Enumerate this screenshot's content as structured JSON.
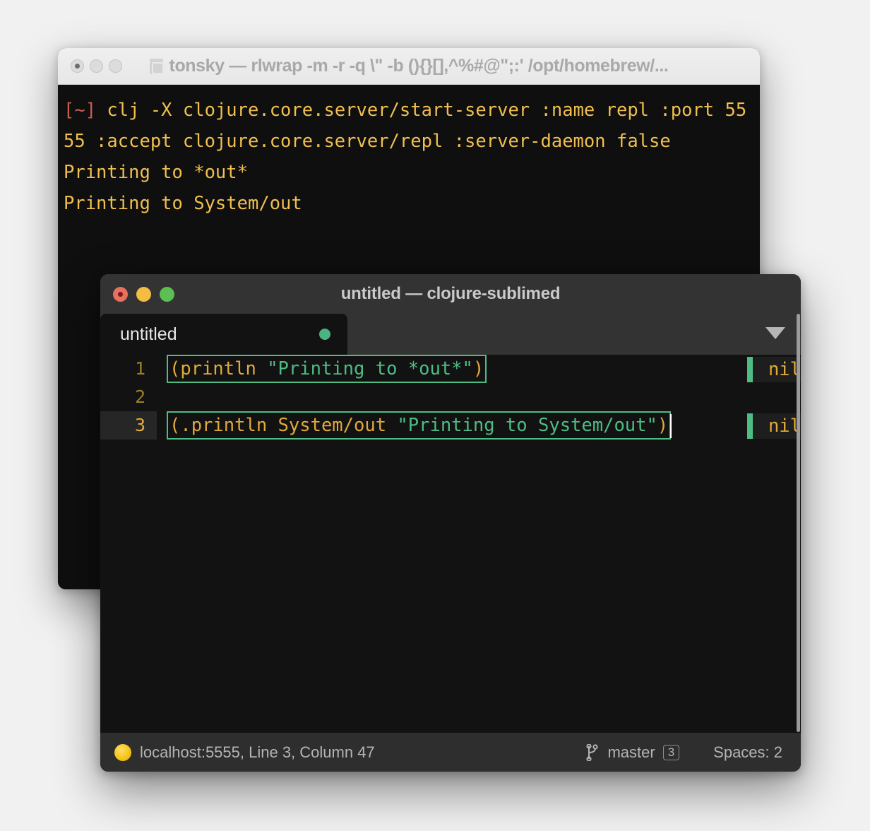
{
  "terminal": {
    "title": "tonsky — rlwrap -m -r -q \\\" -b (){}[],^%#@\";:' /opt/homebrew/...",
    "folder_icon": "folder-icon",
    "traffic_lights": [
      "close-inactive",
      "minimize-inactive",
      "zoom-inactive"
    ],
    "lines": [
      {
        "prompt": "[~]",
        "text": " clj -X clojure.core.server/start-server :name repl :port 5555 :accept clojure.core.server/repl :server-daemon false"
      },
      {
        "prompt": "",
        "text": "Printing to *out*"
      },
      {
        "prompt": "",
        "text": "Printing to System/out"
      }
    ],
    "colors": {
      "prompt": "#c7604f",
      "text": "#f0bf4f",
      "background": "#0f0f0f"
    }
  },
  "sublime": {
    "title": "untitled — clojure-sublimed",
    "traffic_lights": [
      {
        "name": "close",
        "color": "#e8705f"
      },
      {
        "name": "minimize",
        "color": "#f5bc42"
      },
      {
        "name": "zoom",
        "color": "#5bbf52"
      }
    ],
    "tab": {
      "label": "untitled",
      "dirty": true,
      "dirty_color": "#4db382"
    },
    "tab_dropdown_icon": "chevron-down-icon",
    "editor": {
      "lines": [
        {
          "number": "1",
          "selected": true,
          "current": false,
          "cursor": false,
          "tokens": [
            {
              "type": "paren",
              "text": "("
            },
            {
              "type": "sym",
              "text": "println "
            },
            {
              "type": "str",
              "text": "\"Printing to *out*\""
            },
            {
              "type": "paren",
              "text": ")"
            }
          ],
          "result": "nil"
        },
        {
          "number": "2",
          "selected": false,
          "current": false,
          "cursor": false,
          "tokens": [],
          "result": ""
        },
        {
          "number": "3",
          "selected": true,
          "current": true,
          "cursor": true,
          "tokens": [
            {
              "type": "paren",
              "text": "("
            },
            {
              "type": "sym",
              "text": ".println System/out "
            },
            {
              "type": "str",
              "text": "\"Printing to System/out\""
            },
            {
              "type": "paren",
              "text": ")"
            }
          ],
          "result": "nil"
        }
      ],
      "colors": {
        "background": "#121212",
        "selection_border": "#4dbd84",
        "string": "#4dbd84",
        "symbol": "#e0a93a",
        "gutter": "#9a7e28",
        "result_value": "#e0a93a",
        "result_bar": "#4dbd84"
      }
    },
    "statusbar": {
      "moon_icon": "moon-icon",
      "position": "localhost:5555, Line 3, Column 47",
      "branch_icon": "git-branch-icon",
      "branch": "master",
      "branch_badge": "3",
      "spaces": "Spaces: 2"
    }
  }
}
